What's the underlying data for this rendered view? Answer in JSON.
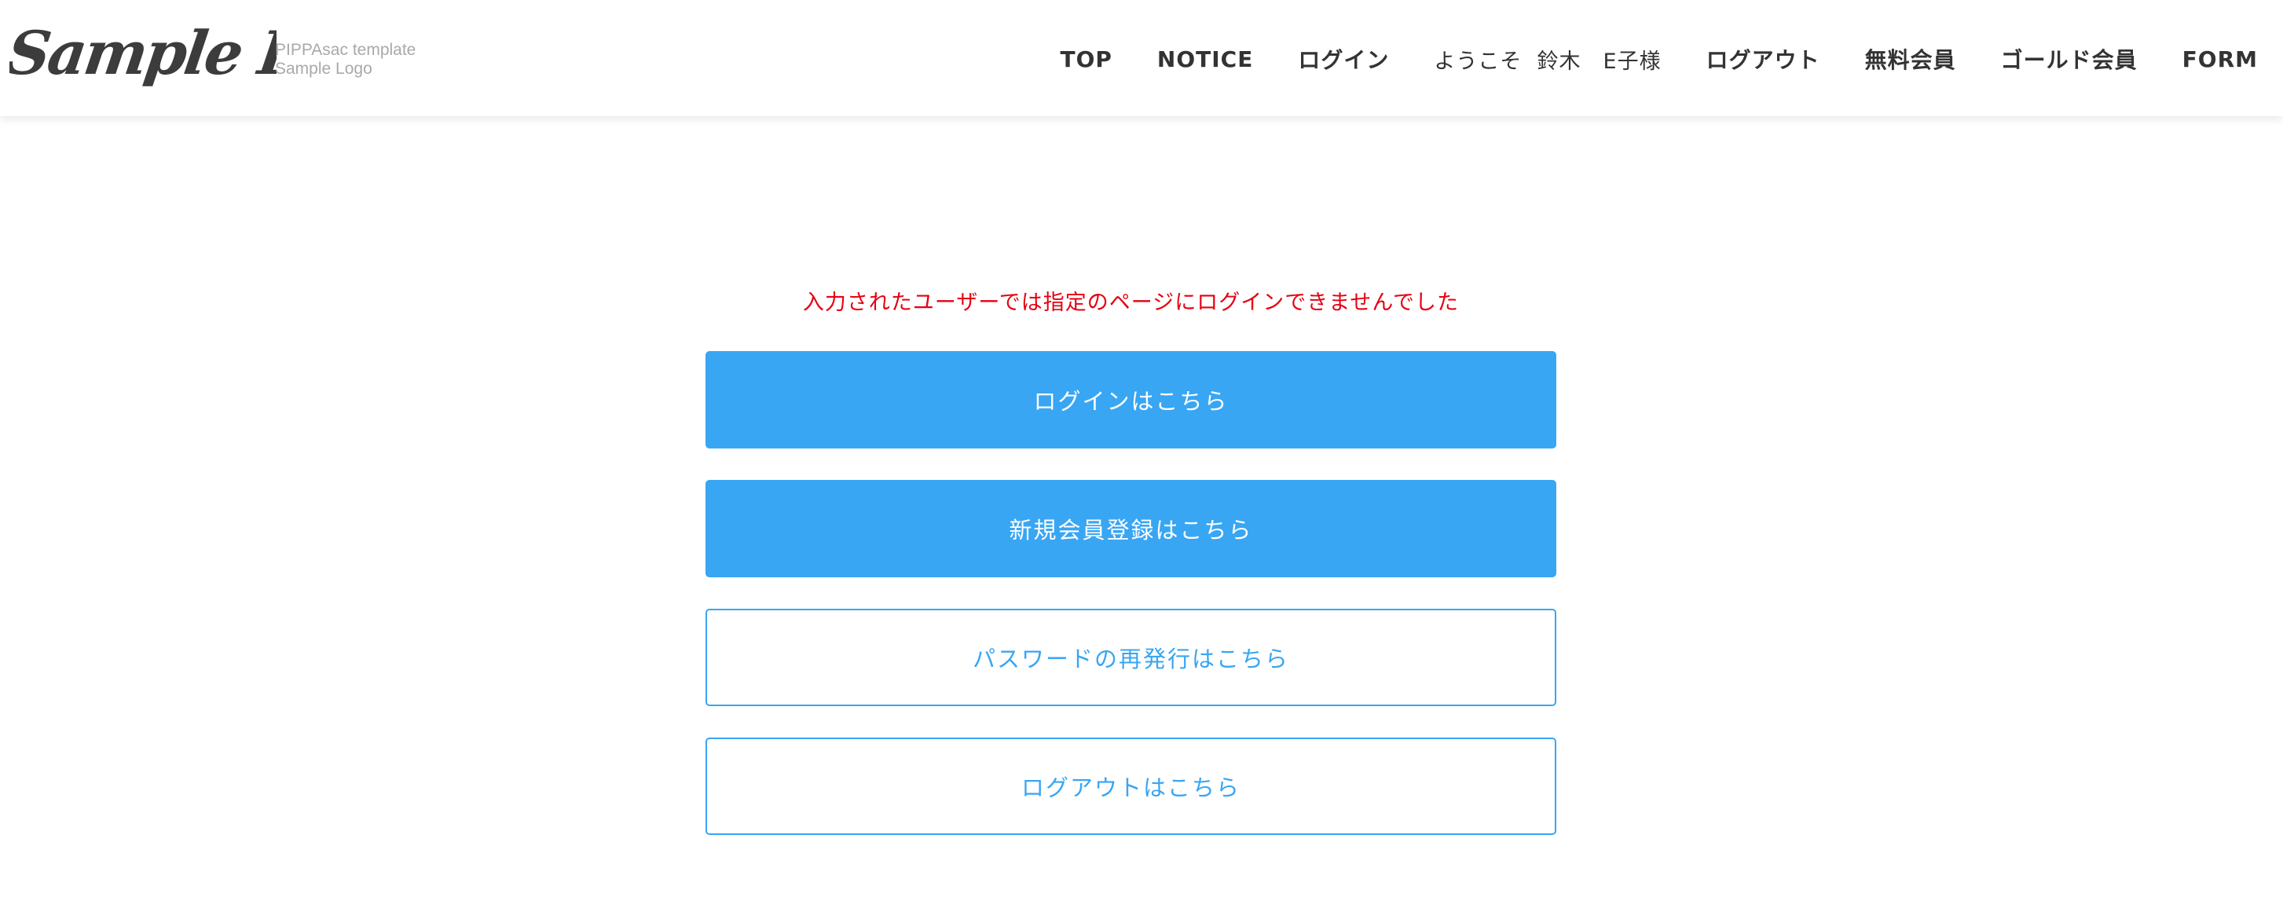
{
  "header": {
    "logo": {
      "text": "Sample Logo",
      "subtitle_line1": "PIPPAsac template",
      "subtitle_line2": "Sample Logo"
    },
    "nav": {
      "top": "TOP",
      "notice": "NOTICE",
      "login": "ログイン",
      "welcome": "ようこそ  鈴木　E子様",
      "logout": "ログアウト",
      "free_member": "無料会員",
      "gold_member": "ゴールド会員",
      "form": "FORM"
    }
  },
  "main": {
    "error_message": "入力されたユーザーでは指定のページにログインできませんでした",
    "buttons": {
      "login": "ログインはこちら",
      "register": "新規会員登録はこちら",
      "password_reset": "パスワードの再発行はこちら",
      "logout": "ログアウトはこちら"
    }
  },
  "colors": {
    "accent": "#38a6f3",
    "error": "#e60012",
    "nav_text": "#333333",
    "logo": "#3c3c3c",
    "logo_sub": "#a9a9a9"
  }
}
